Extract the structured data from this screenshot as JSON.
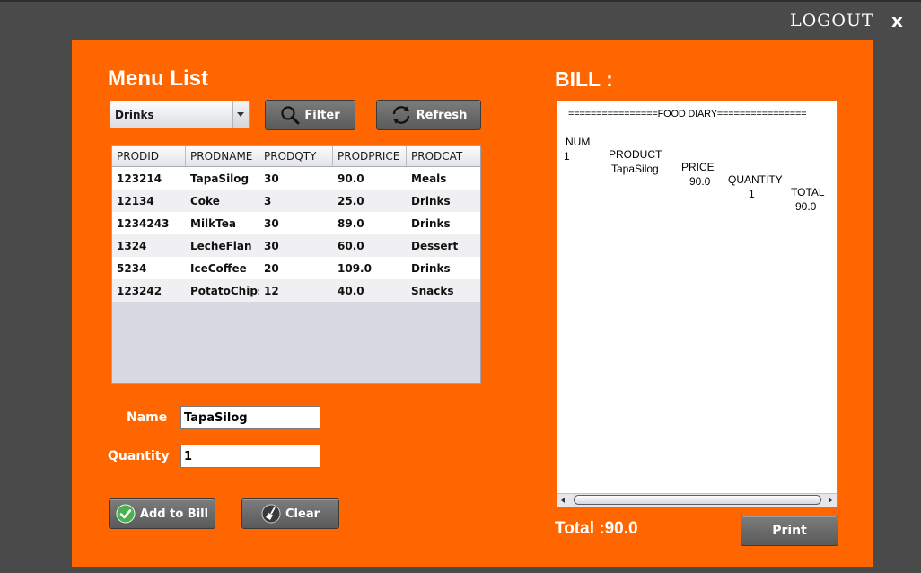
{
  "window": {
    "logout_label": "LOGOUT",
    "close_label": "x"
  },
  "menu": {
    "title": "Menu List",
    "category_selected": "Drinks",
    "filter_label": "Filter",
    "refresh_label": "Refresh",
    "columns": [
      "PRODID",
      "PRODNAME",
      "PRODQTY",
      "PRODPRICE",
      "PRODCAT"
    ],
    "rows": [
      [
        "123214",
        "TapaSilog",
        "30",
        "90.0",
        "Meals"
      ],
      [
        "12134",
        "Coke",
        "3",
        "25.0",
        "Drinks"
      ],
      [
        "1234243",
        "MilkTea",
        "30",
        "89.0",
        "Drinks"
      ],
      [
        "1324",
        "LecheFlan",
        "30",
        "60.0",
        "Dessert"
      ],
      [
        "5234",
        "IceCoffee",
        "20",
        "109.0",
        "Drinks"
      ],
      [
        "123242",
        "PotatoChips",
        "12",
        "40.0",
        "Snacks"
      ]
    ]
  },
  "form": {
    "name_label": "Name",
    "name_value": "TapaSilog",
    "quantity_label": "Quantity",
    "quantity_value": "1",
    "add_label": "Add to Bill",
    "clear_label": "Clear"
  },
  "bill": {
    "title": "BILL :",
    "separator": "================FOOD DIARY================",
    "columns": [
      "NUM",
      "PRODUCT",
      "PRICE",
      "QUANTITY",
      "TOTAL"
    ],
    "items": [
      [
        "1",
        "TapaSilog",
        "90.0",
        "1",
        "90.0"
      ]
    ],
    "total_label": "Total :90.0",
    "print_label": "Print"
  },
  "colors": {
    "panel": "#ff6600",
    "background": "#4a4a4a",
    "button": "#6a6a6a"
  }
}
